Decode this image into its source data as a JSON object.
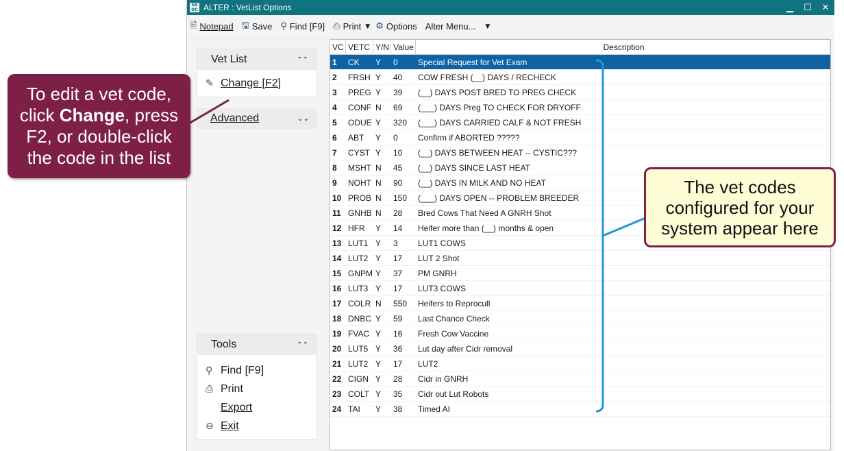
{
  "window": {
    "app_icon": "SB\nDC",
    "title": "ALTER : VetList Options",
    "controls": {
      "minimize": "▁",
      "maximize": "☐",
      "close": "✕"
    }
  },
  "toolbar": {
    "notepad_label": "Notepad",
    "save_label": "Save",
    "find_label": "Find [F9]",
    "print_label": "Print",
    "options_label": "Options",
    "alter_menu_label": "Alter Menu..."
  },
  "sidebar": {
    "vet_list": {
      "header": "Vet List",
      "change_label": "Change [F2]"
    },
    "advanced": {
      "header": "Advanced"
    },
    "tools": {
      "header": "Tools",
      "items": [
        {
          "label": "Find [F9]"
        },
        {
          "label": "Print"
        },
        {
          "label": "Export"
        },
        {
          "label": "Exit"
        }
      ]
    }
  },
  "grid": {
    "columns": {
      "vc": "VC",
      "code": "VETC",
      "yn": "Y/N",
      "value": "Value",
      "description": "Description"
    },
    "rows": [
      {
        "vc": "1",
        "code": "CK",
        "yn": "Y",
        "value": "0",
        "description": "Special Request for Vet Exam"
      },
      {
        "vc": "2",
        "code": "FRSH",
        "yn": "Y",
        "value": "40",
        "description": "COW FRESH (__) DAYS / RECHECK"
      },
      {
        "vc": "3",
        "code": "PREG",
        "yn": "Y",
        "value": "39",
        "description": "(__) DAYS POST BRED TO PREG CHECK"
      },
      {
        "vc": "4",
        "code": "CONF",
        "yn": "N",
        "value": "69",
        "description": "(___) DAYS Preg TO CHECK FOR DRYOFF"
      },
      {
        "vc": "5",
        "code": "ODUE",
        "yn": "Y",
        "value": "320",
        "description": "(___) DAYS CARRIED CALF & NOT FRESH"
      },
      {
        "vc": "6",
        "code": "ABT",
        "yn": "Y",
        "value": "0",
        "description": "Confirm if ABORTED ?????"
      },
      {
        "vc": "7",
        "code": "CYST",
        "yn": "Y",
        "value": "10",
        "description": "(__) DAYS BETWEEN HEAT -- CYSTIC???"
      },
      {
        "vc": "8",
        "code": "MSHT",
        "yn": "N",
        "value": "45",
        "description": "(__) DAYS SINCE LAST HEAT"
      },
      {
        "vc": "9",
        "code": "NOHT",
        "yn": "N",
        "value": "90",
        "description": "(__) DAYS IN MILK AND NO HEAT"
      },
      {
        "vc": "10",
        "code": "PROB",
        "yn": "N",
        "value": "150",
        "description": "(___) DAYS OPEN -- PROBLEM BREEDER"
      },
      {
        "vc": "11",
        "code": "GNHB",
        "yn": "N",
        "value": "28",
        "description": "Bred Cows That Need A GNRH Shot"
      },
      {
        "vc": "12",
        "code": "HFR",
        "yn": "Y",
        "value": "14",
        "description": "Heifer more than (__) months & open"
      },
      {
        "vc": "13",
        "code": "LUT1",
        "yn": "Y",
        "value": "3",
        "description": "LUT1 COWS"
      },
      {
        "vc": "14",
        "code": "LUT2",
        "yn": "Y",
        "value": "17",
        "description": "LUT 2 Shot"
      },
      {
        "vc": "15",
        "code": "GNPM",
        "yn": "Y",
        "value": "37",
        "description": "PM GNRH"
      },
      {
        "vc": "16",
        "code": "LUT3",
        "yn": "Y",
        "value": "17",
        "description": "LUT3 COWS"
      },
      {
        "vc": "17",
        "code": "COLR",
        "yn": "N",
        "value": "550",
        "description": "Heifers to Reprocull"
      },
      {
        "vc": "18",
        "code": "DNBC",
        "yn": "Y",
        "value": "59",
        "description": "Last Chance Check"
      },
      {
        "vc": "19",
        "code": "FVAC",
        "yn": "Y",
        "value": "16",
        "description": "Fresh Cow Vaccine"
      },
      {
        "vc": "20",
        "code": "LUT5",
        "yn": "Y",
        "value": "36",
        "description": "Lut day after Cidr removal"
      },
      {
        "vc": "21",
        "code": "LUT2",
        "yn": "Y",
        "value": "17",
        "description": "LUT2"
      },
      {
        "vc": "22",
        "code": "CIGN",
        "yn": "Y",
        "value": "28",
        "description": "Cidr in GNRH"
      },
      {
        "vc": "23",
        "code": "COLT",
        "yn": "Y",
        "value": "35",
        "description": "Cidr out Lut Robots"
      },
      {
        "vc": "24",
        "code": "TAI",
        "yn": "Y",
        "value": "38",
        "description": "Timed AI"
      }
    ]
  },
  "callouts": {
    "left": {
      "pre": "To edit a vet code, click ",
      "bold": "Change",
      "post": ", press F2, or double-click the code in the list"
    },
    "right": {
      "text": "The vet codes configured for your system appear here"
    }
  },
  "colors": {
    "titlebar": "#0f7480",
    "selected_row": "#0f63a4",
    "callout_fill": "#7d1f47",
    "note_fill": "#fffdd6",
    "bracket": "#1a9ad6"
  },
  "icons": {
    "notepad": "notepad-icon",
    "save": "save-icon",
    "find": "magnifier-icon",
    "print": "printer-icon",
    "options": "gear-icon",
    "change": "pencil-icon",
    "exit": "exit-circle-icon"
  }
}
